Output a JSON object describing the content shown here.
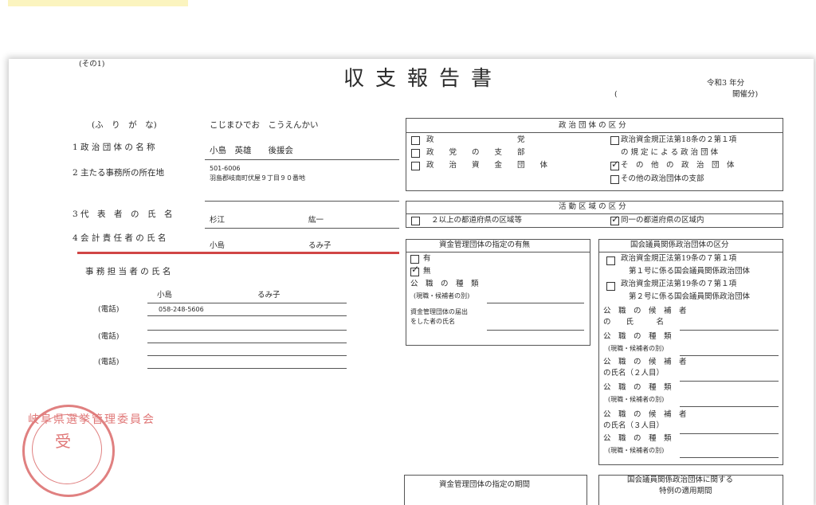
{
  "form": {
    "note_left": "(その1)",
    "title": "収支報告書",
    "era_year": "令和3 年分",
    "paren_open": "(",
    "paren_close": "開催分)"
  },
  "left": {
    "furigana_label": "(ふ　り　が　な)",
    "furigana_value": "こじまひでお　こうえんかい",
    "org_name_label": "1 政 治 団 体 の 名 称",
    "org_name_value": "小島　英雄　　後援会",
    "office_label": "2 主たる事務所の所在地",
    "postal": "501-6006",
    "address": "羽島郡岐南町伏屋９丁目９０番地",
    "rep_label": "3 代　表　者　の　氏　名",
    "rep_surname": "杉江",
    "rep_given": "紘一",
    "treasurer_label": "4 会 計 責 任 者 の 氏 名",
    "treasurer_surname": "小島",
    "treasurer_given": "るみ子",
    "clerk_label": "事 務 担 当 者 の 氏 名",
    "clerk_surname": "小島",
    "clerk_given": "るみ子",
    "tel_label": "(電話)",
    "tel_1": "058-248-5606"
  },
  "stamp": {
    "text": "岐阜県選挙管理委員会",
    "center": "受"
  },
  "political_org": {
    "header": "政 治 団 体 の 区 分",
    "opt_party": "政　　　　　　　　　　　党",
    "opt_branch": "政　　党　　の　　支　　部",
    "opt_fund": "政　　治　　資　　金　　団　　体",
    "opt_law_1": "政治資金規正法第18条の２第１項",
    "opt_law_2": "の 規 定 に よ る 政 治 団 体",
    "opt_other": "そ　の　他　の　政　治　団　体",
    "opt_other_branch": "その他の政治団体の支部",
    "selected": "other"
  },
  "activity": {
    "header": "活 動 区 域 の 区 分",
    "opt_multi": "２以上の都道府県の区域等",
    "opt_single": "同一の都道府県の区域内",
    "selected": "single"
  },
  "fund_designation": {
    "header": "資金管理団体の指定の有無",
    "yes": "有",
    "no": "無",
    "selected": "no",
    "office_type": "公　職　の　種　類",
    "office_type_note": "(現職・候補者の別)",
    "applicant_1": "資金管理団体の届出",
    "applicant_2": "をした者の氏名"
  },
  "diet_member": {
    "header": "国会議員関係政治団体の区分",
    "opt1_a": "政治資金規正法第19条の７第１項",
    "opt1_b": "第１号に係る国会議員関係政治団体",
    "opt2_a": "政治資金規正法第19条の７第１項",
    "opt2_b": "第２号に係る国会議員関係政治団体",
    "candidate_a": "公　職　の　候　補　者",
    "candidate_b": "の　　氏　　　名",
    "office_type": "公　職　の　種　類",
    "office_note": "(現職・候補者の別)",
    "cand2_a": "公　職　の　候　補　者",
    "cand2_b": "の氏名（２人目）",
    "cand3_a": "公　職　の　候　補　者",
    "cand3_b": "の氏名（３人目）"
  },
  "bottom": {
    "fund_period": "資金管理団体の指定の期間",
    "diet_special_1": "国会議員関係政治団体に関する",
    "diet_special_2": "特例の適用期間"
  }
}
